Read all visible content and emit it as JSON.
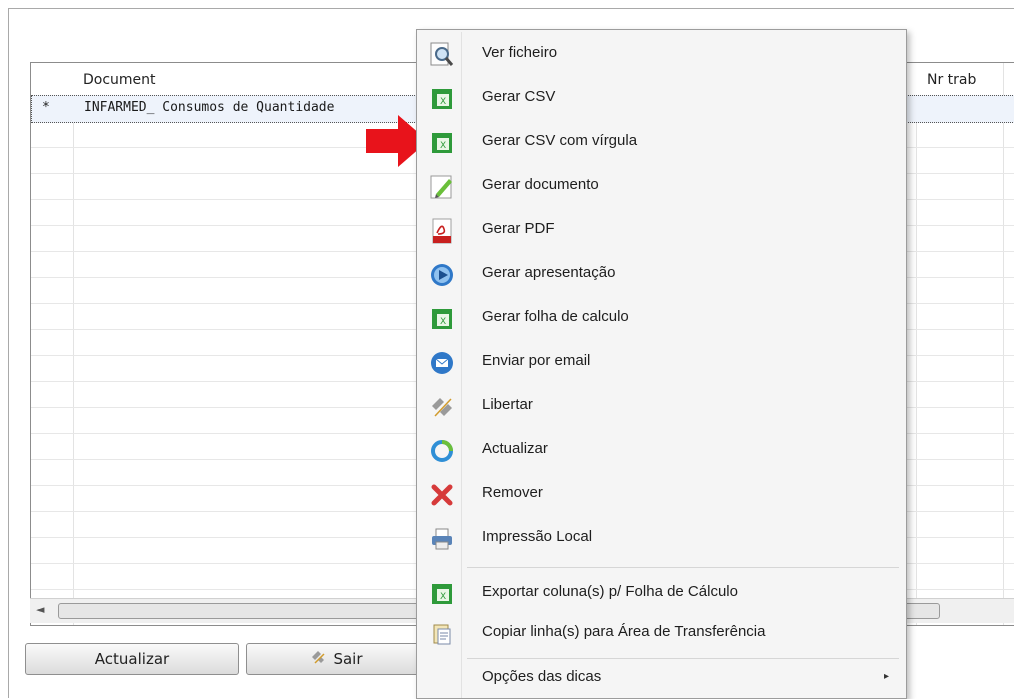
{
  "grid": {
    "columns": [
      "Document",
      "Nr trab"
    ],
    "rows": [
      {
        "marker": "*",
        "document": "INFARMED_ Consumos de Quantidade"
      }
    ],
    "scroll_left_glyph": "◄"
  },
  "buttons": {
    "actualizar": "Actualizar",
    "sair": "Sair"
  },
  "context_menu": {
    "items": [
      {
        "label": "Ver ficheiro",
        "icon": "magnifier-icon"
      },
      {
        "label": "Gerar CSV",
        "icon": "spreadsheet-icon"
      },
      {
        "label": "Gerar CSV com vírgula",
        "icon": "spreadsheet-icon"
      },
      {
        "label": "Gerar documento",
        "icon": "pencil-icon"
      },
      {
        "label": "Gerar PDF",
        "icon": "pdf-icon"
      },
      {
        "label": "Gerar apresentação",
        "icon": "play-icon"
      },
      {
        "label": "Gerar folha de calculo",
        "icon": "spreadsheet-icon"
      },
      {
        "label": "Enviar por email",
        "icon": "email-icon"
      },
      {
        "label": "Libertar",
        "icon": "unlink-icon"
      },
      {
        "label": "Actualizar",
        "icon": "refresh-icon"
      },
      {
        "label": "Remover",
        "icon": "remove-icon"
      },
      {
        "label": "Impressão Local",
        "icon": "printer-icon"
      },
      {
        "label": "Exportar coluna(s) p/ Folha de Cálculo",
        "icon": "spreadsheet-icon"
      },
      {
        "label": "Copiar linha(s) para Área de Transferência",
        "icon": "clipboard-icon"
      },
      {
        "label": "Opções das dicas",
        "icon": "",
        "submenu_glyph": "▸"
      }
    ]
  },
  "colors": {
    "accent_red": "#e8131b",
    "spreadsheet_green": "#2e9a3a",
    "pdf_red": "#c8201f",
    "blue": "#2f78c8"
  }
}
